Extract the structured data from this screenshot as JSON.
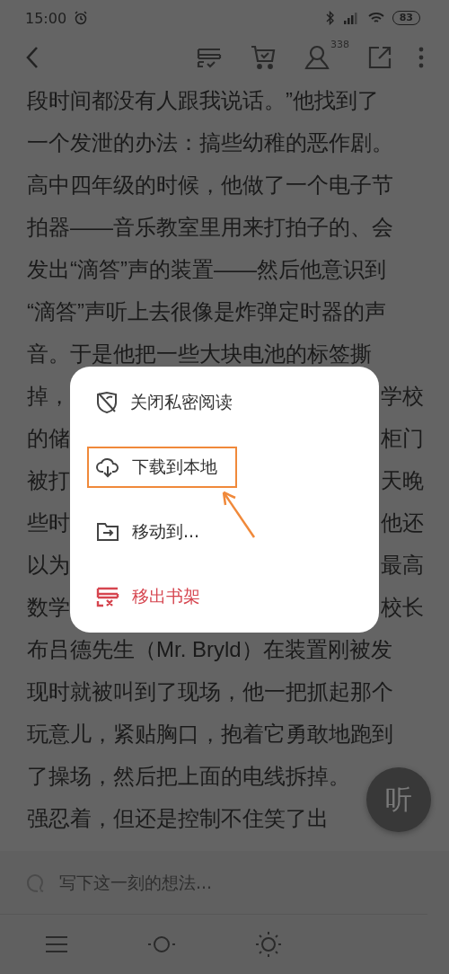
{
  "status_bar": {
    "time": "15:00",
    "battery": "83"
  },
  "header": {
    "followers_badge": "338"
  },
  "content": {
    "lines": [
      {
        "kind": "full",
        "text": "段时间都没有人跟我说话。”他找到了"
      },
      {
        "kind": "full",
        "text": "一个发泄的办法：搞些幼稚的恶作剧。"
      },
      {
        "kind": "full",
        "text": "高中四年级的时候，他做了一个电子节"
      },
      {
        "kind": "full",
        "text": "拍器——音乐教室里用来打拍子的、会"
      },
      {
        "kind": "full",
        "text": "发出“滴答”声的装置——然后他意识到"
      },
      {
        "kind": "full",
        "text": "“滴答”声听上去很像是炸弹定时器的声"
      },
      {
        "kind": "full",
        "text": "音。于是他把一些大块电池的标签撕"
      },
      {
        "kind": "split",
        "left": "掉，",
        "right": "学校"
      },
      {
        "kind": "split",
        "left": "的储",
        "right": "柜门"
      },
      {
        "kind": "split",
        "left": "被打",
        "right": "天晚"
      },
      {
        "kind": "split",
        "left": "些时",
        "right": "他还"
      },
      {
        "kind": "split",
        "left": "以为",
        "right": "最高"
      },
      {
        "kind": "split",
        "left": "数学",
        "right": "校长"
      },
      {
        "kind": "full",
        "text": "布吕德先生（Mr. Bryld）在装置刚被发"
      },
      {
        "kind": "full",
        "text": "现时就被叫到了现场，他一把抓起那个"
      },
      {
        "kind": "full",
        "text": "玩意儿，紧贴胸口，抱着它勇敢地跑到"
      },
      {
        "kind": "full",
        "text": "了操场，然后把上面的电线拆掉。"
      },
      {
        "kind": "full",
        "text": "强忍着，但还是控制不住笑了出"
      }
    ]
  },
  "menu": {
    "items": [
      {
        "kind": "private",
        "label": "关闭私密阅读",
        "highlighted": false
      },
      {
        "kind": "download",
        "label": "下载到本地",
        "highlighted": true
      },
      {
        "kind": "move",
        "label": "移动到...",
        "highlighted": false
      },
      {
        "kind": "remove",
        "label": "移出书架",
        "highlighted": false
      }
    ]
  },
  "listen_button": {
    "label": "听"
  },
  "comment": {
    "placeholder": "写下这一刻的想法..."
  }
}
